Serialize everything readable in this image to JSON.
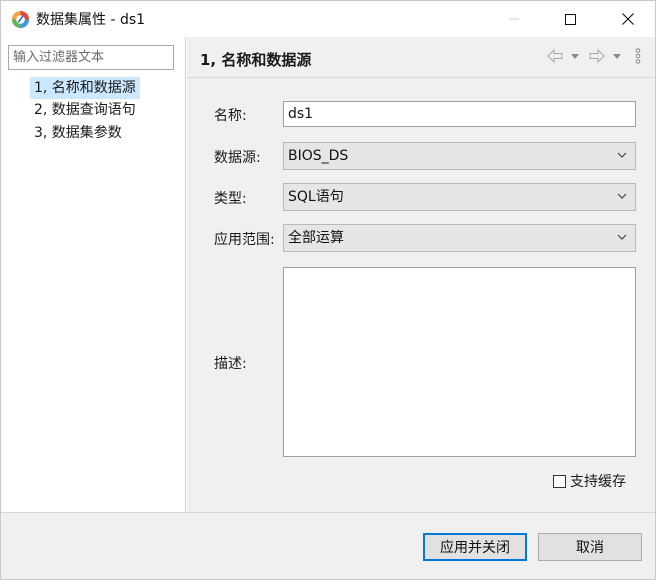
{
  "window": {
    "title": "数据集属性 - ds1",
    "icons": {
      "app": "report-app-icon",
      "minimize": "minimize-icon",
      "maximize": "maximize-icon",
      "close": "close-icon"
    }
  },
  "sidebar": {
    "filter_placeholder": "输入过滤器文本",
    "items": [
      {
        "label": "1, 名称和数据源",
        "selected": true
      },
      {
        "label": "2, 数据查询语句",
        "selected": false
      },
      {
        "label": "3, 数据集参数",
        "selected": false
      }
    ]
  },
  "page": {
    "title": "1, 名称和数据源",
    "nav_icons": [
      "back-arrow-icon",
      "chevron-down-icon",
      "forward-arrow-icon",
      "chevron-down-icon",
      "more-vertical-icon"
    ]
  },
  "form": {
    "name": {
      "label": "名称:",
      "value": "ds1"
    },
    "datasource": {
      "label": "数据源:",
      "value": "BIOS_DS"
    },
    "type": {
      "label": "类型:",
      "value": "SQL语句"
    },
    "scope": {
      "label": "应用范围:",
      "value": "全部运算"
    },
    "description": {
      "label": "描述:",
      "value": ""
    },
    "cache": {
      "label": "支持缓存",
      "checked": false
    }
  },
  "buttons": {
    "apply_close": "应用并关闭",
    "cancel": "取消"
  },
  "colors": {
    "selection": "#cce8ff",
    "primary_border": "#0078d7",
    "pane_background": "#f0f0f0"
  }
}
